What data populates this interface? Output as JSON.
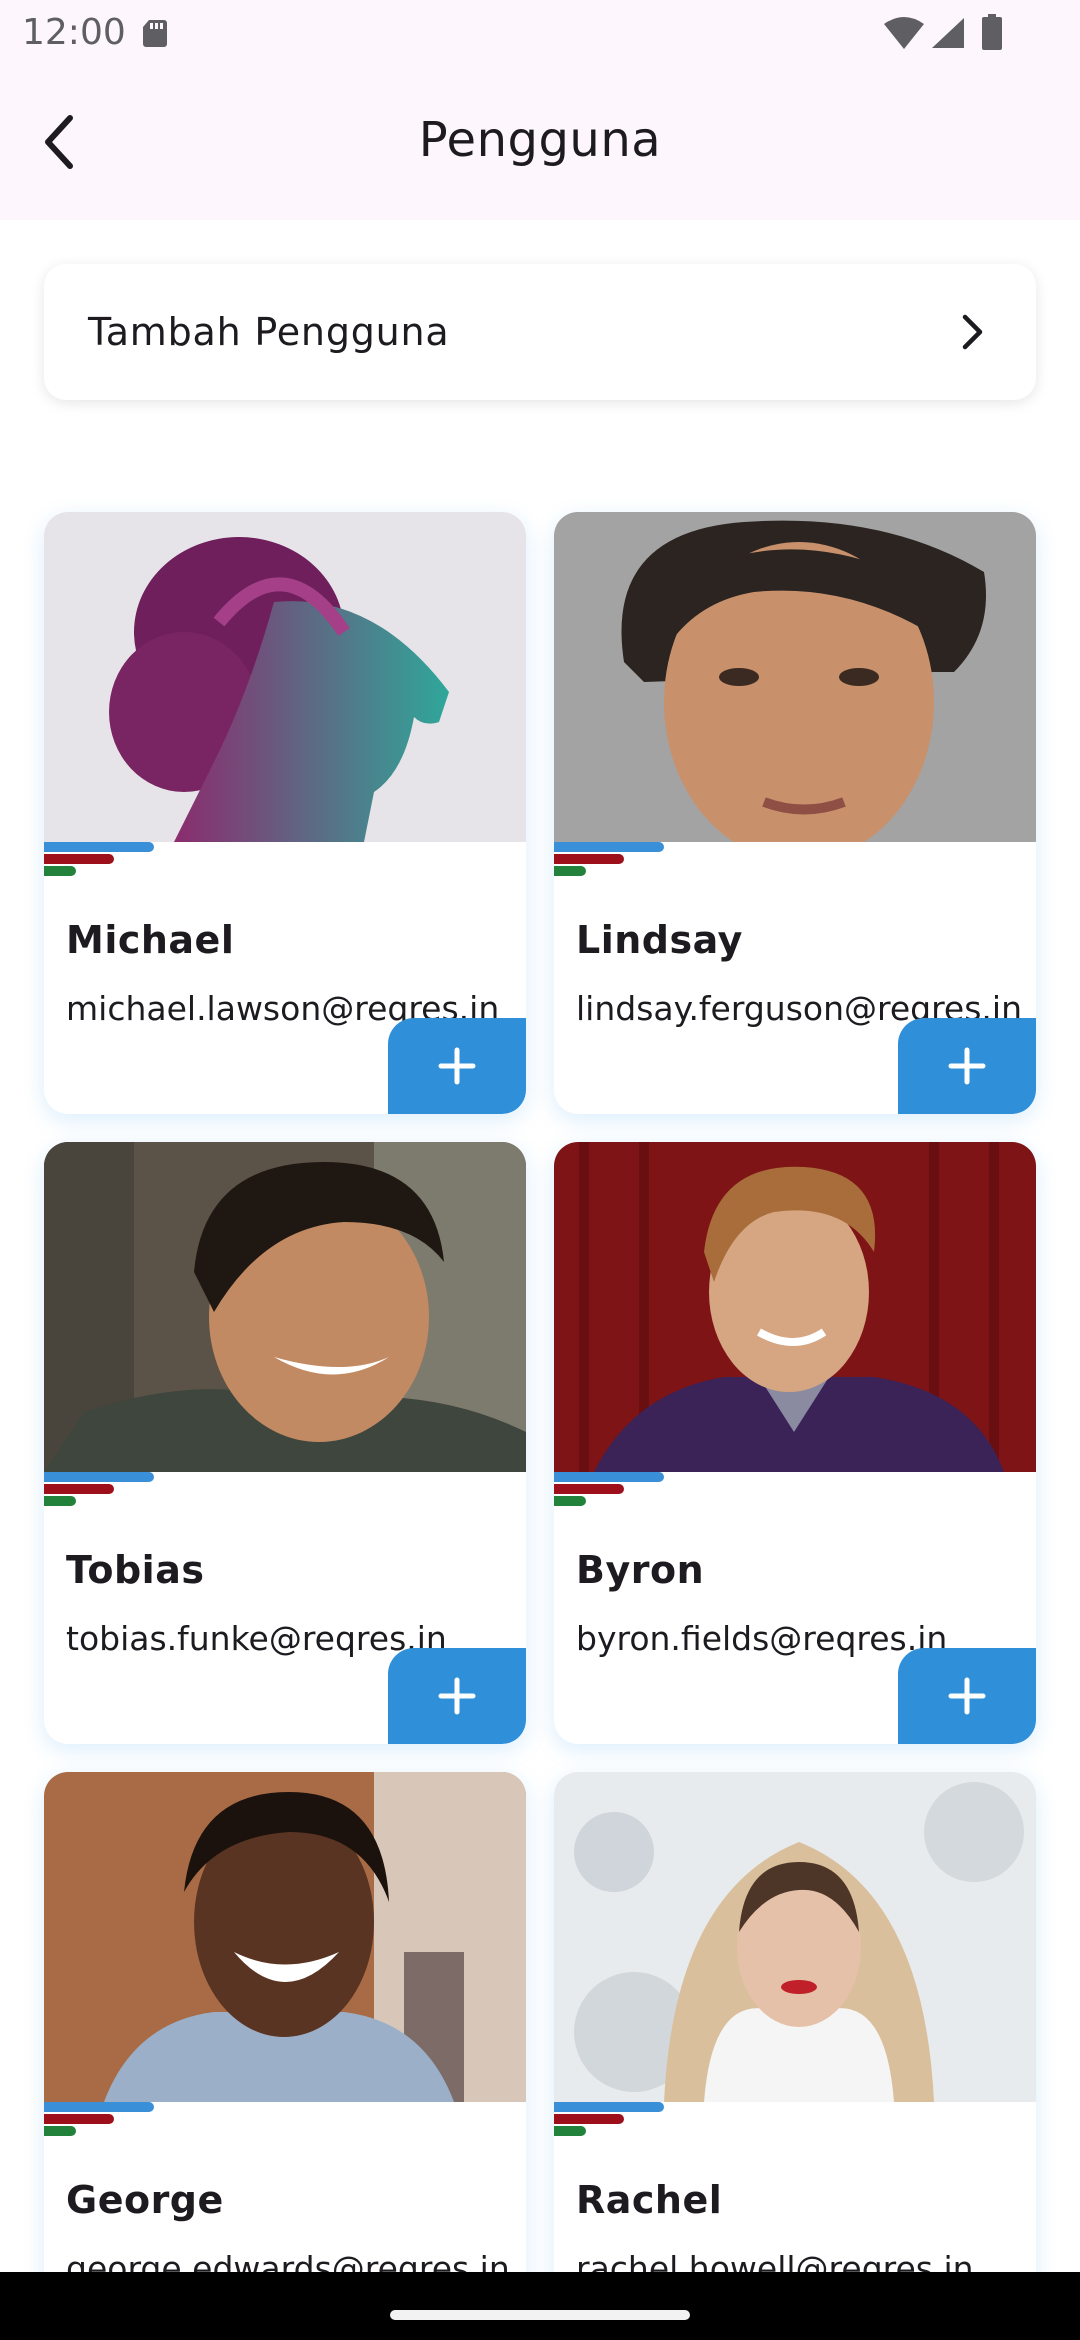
{
  "status_bar": {
    "time": "12:00",
    "icons": [
      "sd-card-icon",
      "wifi-icon",
      "signal-icon",
      "battery-icon"
    ]
  },
  "app_bar": {
    "title": "Pengguna",
    "back_icon": "chevron-left-icon"
  },
  "add_user": {
    "label": "Tambah Pengguna",
    "icon": "chevron-right-icon"
  },
  "colors": {
    "accent_blue": "#2f8fd8",
    "accent_red": "#9e0f1c",
    "accent_green": "#22813a",
    "app_bar_bg": "#fdf7fd"
  },
  "users": [
    {
      "name": "Michael",
      "email": "michael.lawson@reqres.in"
    },
    {
      "name": "Lindsay",
      "email": "lindsay.ferguson@reqres.in"
    },
    {
      "name": "Tobias",
      "email": "tobias.funke@reqres.in"
    },
    {
      "name": "Byron",
      "email": "byron.fields@reqres.in"
    },
    {
      "name": "George",
      "email": "george.edwards@reqres.in"
    },
    {
      "name": "Rachel",
      "email": "rachel.howell@reqres.in"
    }
  ]
}
